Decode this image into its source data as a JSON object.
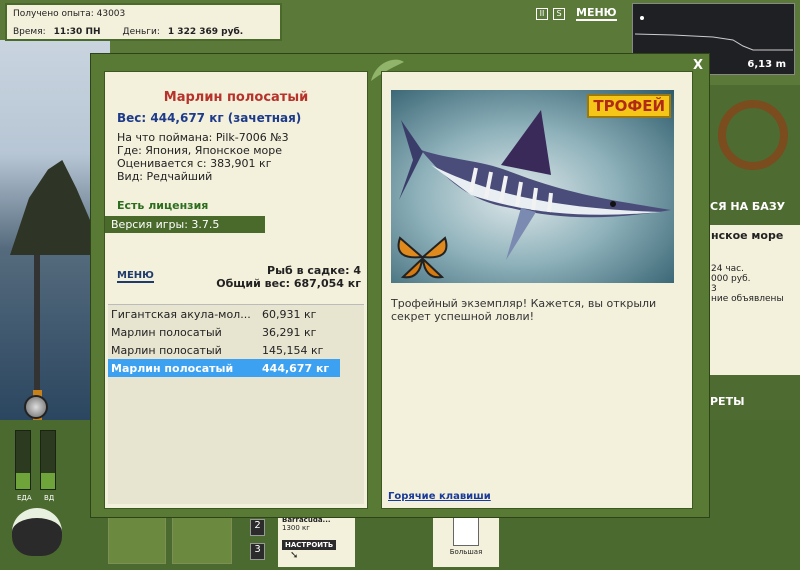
{
  "top_info": {
    "xp_label": "Получено опыта:",
    "xp_value": "43003",
    "time_label": "Время:",
    "time_value": "11:30 ПН",
    "money_label": "Деньги:",
    "money_value": "1 322 369 руб."
  },
  "top_menu": {
    "menu_label": "МЕНЮ"
  },
  "depth": {
    "value": "6,13 m"
  },
  "right_panel": {
    "base_label": "СЯ НА БАЗУ",
    "region": "нское море",
    "line1": "24 час.",
    "line2": "000 руб.",
    "line3": "3",
    "line4": "ние объявлены",
    "secrets": "РЕТЫ"
  },
  "gauges": {
    "food_label": "ЕДА",
    "drive_label": "ВД",
    "food_level": 0.28,
    "drive_level": 0.28
  },
  "bottom": {
    "slot2": "2",
    "slot3": "3",
    "bait_name": "Barracuda...",
    "bait_weight": "1300 кг",
    "setup_label": "НАСТРОИТЬ",
    "note_label": "Большая"
  },
  "dialog": {
    "fish_name": "Марлин полосатый",
    "weight": "Вес: 444,677 кг (зачетная)",
    "caught_with": "На что поймана: Pilk-7006 №3",
    "where": "Где: Япония, Японское море",
    "valued_from": "Оценивается с: 383,901 кг",
    "kind": "Вид: Редчайший",
    "license": "Есть лицензия",
    "version": "Версия игры: 3.7.5",
    "menu_label": "МЕНЮ",
    "cage_count": "Рыб в садке: 4",
    "total_weight": "Общий вес: 687,054 кг",
    "catch_list": [
      {
        "name": "Гигантская акула-мол...",
        "weight": "60,931 кг"
      },
      {
        "name": "Марлин полосатый",
        "weight": "36,291 кг"
      },
      {
        "name": "Марлин полосатый",
        "weight": "145,154 кг"
      },
      {
        "name": "Марлин полосатый",
        "weight": "444,677 кг"
      }
    ],
    "trophy_badge": "ТРОФЕЙ",
    "description": "Трофейный экземпляр! Кажется, вы открыли секрет успешной ловли!",
    "hotkeys": "Горячие клавиши",
    "close": "X"
  }
}
